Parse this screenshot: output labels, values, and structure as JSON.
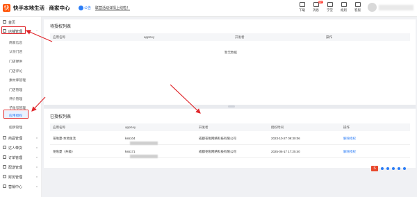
{
  "header": {
    "logo_glyph": "快",
    "app_name": "快手本地生活",
    "separator": "·",
    "section": "商家中心",
    "notice_tag": "公告",
    "notice_text": "联营活动详情上线啦！",
    "tools": [
      {
        "label": "下载",
        "icon": "download-icon"
      },
      {
        "label": "消息",
        "icon": "bell-icon",
        "badge": "99+"
      },
      {
        "label": "学堂",
        "icon": "school-icon"
      },
      {
        "label": "规则",
        "icon": "rules-icon"
      },
      {
        "label": "客服",
        "icon": "service-icon"
      }
    ]
  },
  "sidebar": {
    "home": "首页",
    "store_mgmt": "店铺管理",
    "subitems": [
      "商家信息",
      "认领门店",
      "门店弹供",
      "门店评论",
      "素材库管理",
      "门店管理",
      "评价管理",
      "子账号管理",
      "应用授权",
      "招牌管理"
    ],
    "bottom": [
      {
        "label": "商品管理"
      },
      {
        "label": "达人带货"
      },
      {
        "label": "订单管理"
      },
      {
        "label": "配送管理"
      },
      {
        "label": "财务管理"
      },
      {
        "label": "营销中心"
      }
    ]
  },
  "pending": {
    "title": "待授权列表",
    "columns": [
      "应用名称",
      "appKey",
      "开发者",
      "操作"
    ],
    "empty": "暂无数据"
  },
  "authorized": {
    "title": "已授权列表",
    "columns": [
      "应用名称",
      "appKey",
      "开发者",
      "授权时间",
      "操作"
    ],
    "rows": [
      {
        "name": "花啦夏-本地生活",
        "key_prefix": "ks6",
        "key_suffix": "104",
        "developer": "成都花啦网络科技有限公司",
        "time": "2023-10-27 09:30:06",
        "action": "解除授权"
      },
      {
        "name": "花啦夏（升级）",
        "key_prefix": "ks6",
        "key_suffix": "171",
        "developer": "成都花啦网络科技有限公司",
        "time": "2025-06-17 17:25:40",
        "action": "解除授权"
      }
    ]
  },
  "colors": {
    "accent": "#2a7cf6",
    "brand": "#ff5000",
    "annotation": "#e0262b"
  }
}
